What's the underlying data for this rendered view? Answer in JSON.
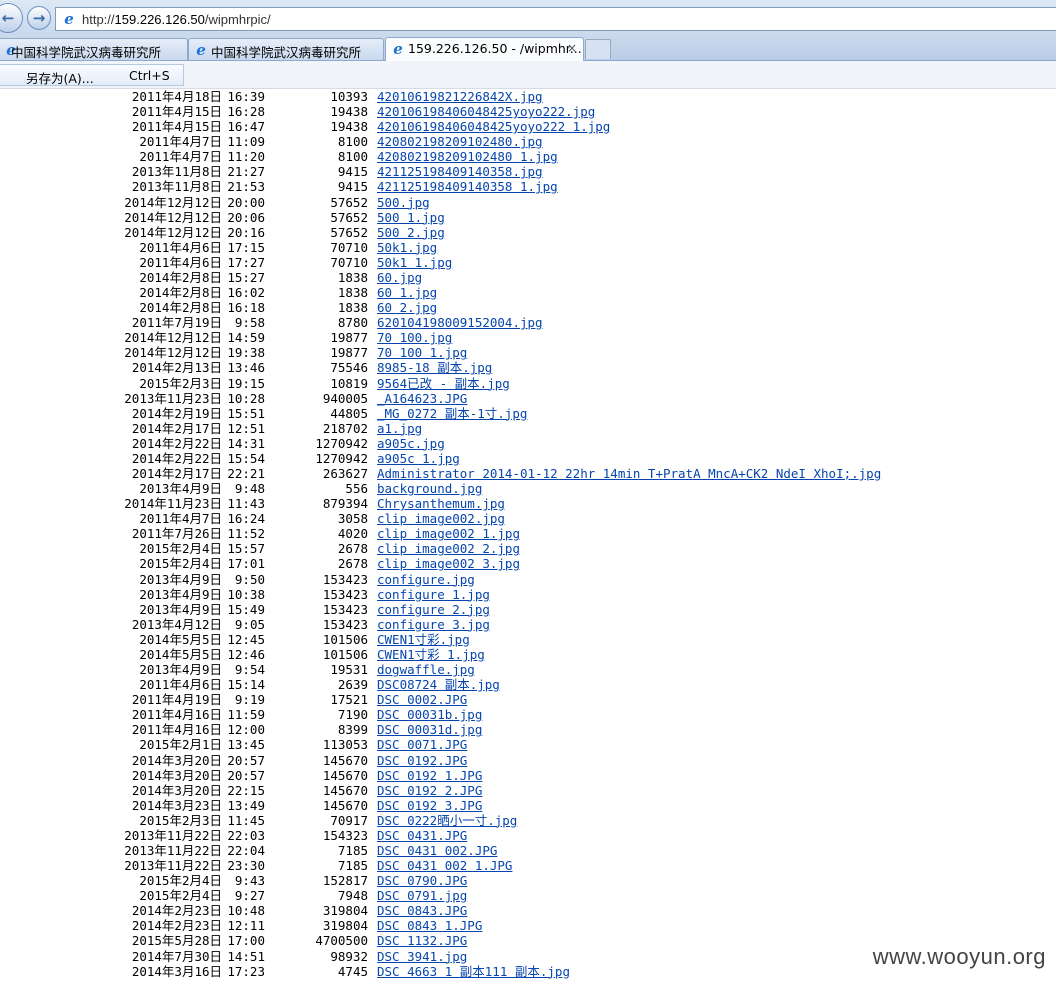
{
  "browser": {
    "url_prefix": "http://",
    "url_host": "159.226.126.50",
    "url_path": "/wipmhrpic/",
    "tabs": [
      {
        "label": "中国科学院武汉病毒研究所",
        "active": false
      },
      {
        "label": "中国科学院武汉病毒研究所",
        "active": false
      },
      {
        "label": "159.226.126.50 - /wipmhr...",
        "active": true,
        "close": "×"
      }
    ],
    "context_menu": {
      "label": "另存为(A)...",
      "shortcut": "Ctrl+S"
    },
    "icons": [
      "back-arrow-icon",
      "forward-arrow-icon",
      "ie-page-icon",
      "close-icon"
    ]
  },
  "colors": {
    "link": "#0645ad",
    "chrome": "#c9d9ec"
  },
  "files": [
    {
      "date": "2011年4月18日",
      "time": "16:39",
      "size": "10393",
      "name": "42010619821226842X.jpg"
    },
    {
      "date": "2011年4月15日",
      "time": "16:28",
      "size": "19438",
      "name": "420106198406048425yoyo222.jpg"
    },
    {
      "date": "2011年4月15日",
      "time": "16:47",
      "size": "19438",
      "name": "420106198406048425yoyo222 1.jpg"
    },
    {
      "date": "2011年4月7日",
      "time": "11:09",
      "size": "8100",
      "name": "420802198209102480.jpg"
    },
    {
      "date": "2011年4月7日",
      "time": "11:20",
      "size": "8100",
      "name": "420802198209102480 1.jpg"
    },
    {
      "date": "2013年11月8日",
      "time": "21:27",
      "size": "9415",
      "name": "421125198409140358.jpg"
    },
    {
      "date": "2013年11月8日",
      "time": "21:53",
      "size": "9415",
      "name": "421125198409140358 1.jpg"
    },
    {
      "date": "2014年12月12日",
      "time": "20:00",
      "size": "57652",
      "name": "500.jpg"
    },
    {
      "date": "2014年12月12日",
      "time": "20:06",
      "size": "57652",
      "name": "500 1.jpg"
    },
    {
      "date": "2014年12月12日",
      "time": "20:16",
      "size": "57652",
      "name": "500 2.jpg"
    },
    {
      "date": "2011年4月6日",
      "time": "17:15",
      "size": "70710",
      "name": "50k1.jpg"
    },
    {
      "date": "2011年4月6日",
      "time": "17:27",
      "size": "70710",
      "name": "50k1 1.jpg"
    },
    {
      "date": "2014年2月8日",
      "time": "15:27",
      "size": "1838",
      "name": "60.jpg"
    },
    {
      "date": "2014年2月8日",
      "time": "16:02",
      "size": "1838",
      "name": "60 1.jpg"
    },
    {
      "date": "2014年2月8日",
      "time": "16:18",
      "size": "1838",
      "name": "60 2.jpg"
    },
    {
      "date": "2011年7月19日",
      "time": "9:58",
      "size": "8780",
      "name": "620104198009152004.jpg"
    },
    {
      "date": "2014年12月12日",
      "time": "14:59",
      "size": "19877",
      "name": "70 100.jpg"
    },
    {
      "date": "2014年12月12日",
      "time": "19:38",
      "size": "19877",
      "name": "70 100 1.jpg"
    },
    {
      "date": "2014年2月13日",
      "time": "13:46",
      "size": "75546",
      "name": "8985-18 副本.jpg"
    },
    {
      "date": "2015年2月3日",
      "time": "19:15",
      "size": "10819",
      "name": "9564已改 - 副本.jpg"
    },
    {
      "date": "2013年11月23日",
      "time": "10:28",
      "size": "940005",
      "name": "_A164623.JPG"
    },
    {
      "date": "2014年2月19日",
      "time": "15:51",
      "size": "44805",
      "name": "_MG_0272 副本-1寸.jpg"
    },
    {
      "date": "2014年2月17日",
      "time": "12:51",
      "size": "218702",
      "name": "a1.jpg"
    },
    {
      "date": "2014年2月22日",
      "time": "14:31",
      "size": "1270942",
      "name": "a905c.jpg"
    },
    {
      "date": "2014年2月22日",
      "time": "15:54",
      "size": "1270942",
      "name": "a905c 1.jpg"
    },
    {
      "date": "2014年2月17日",
      "time": "22:21",
      "size": "263627",
      "name": "Administrator 2014-01-12 22hr 14min T+PratA MncA+CK2 NdeI XhoI;.jpg"
    },
    {
      "date": "2013年4月9日",
      "time": "9:48",
      "size": "556",
      "name": "background.jpg"
    },
    {
      "date": "2014年11月23日",
      "time": "11:43",
      "size": "879394",
      "name": "Chrysanthemum.jpg"
    },
    {
      "date": "2011年4月7日",
      "time": "16:24",
      "size": "3058",
      "name": "clip image002.jpg"
    },
    {
      "date": "2011年7月26日",
      "time": "11:52",
      "size": "4020",
      "name": "clip image002 1.jpg"
    },
    {
      "date": "2015年2月4日",
      "time": "15:57",
      "size": "2678",
      "name": "clip image002 2.jpg"
    },
    {
      "date": "2015年2月4日",
      "time": "17:01",
      "size": "2678",
      "name": "clip image002 3.jpg"
    },
    {
      "date": "2013年4月9日",
      "time": "9:50",
      "size": "153423",
      "name": "configure.jpg"
    },
    {
      "date": "2013年4月9日",
      "time": "10:38",
      "size": "153423",
      "name": "configure 1.jpg"
    },
    {
      "date": "2013年4月9日",
      "time": "15:49",
      "size": "153423",
      "name": "configure 2.jpg"
    },
    {
      "date": "2013年4月12日",
      "time": "9:05",
      "size": "153423",
      "name": "configure 3.jpg"
    },
    {
      "date": "2014年5月5日",
      "time": "12:45",
      "size": "101506",
      "name": "CWEN1寸彩.jpg"
    },
    {
      "date": "2014年5月5日",
      "time": "12:46",
      "size": "101506",
      "name": "CWEN1寸彩 1.jpg"
    },
    {
      "date": "2013年4月9日",
      "time": "9:54",
      "size": "19531",
      "name": "dogwaffle.jpg"
    },
    {
      "date": "2011年4月6日",
      "time": "15:14",
      "size": "2639",
      "name": "DSC08724 副本.jpg"
    },
    {
      "date": "2011年4月19日",
      "time": "9:19",
      "size": "17521",
      "name": "DSC 0002.JPG"
    },
    {
      "date": "2011年4月16日",
      "time": "11:59",
      "size": "7190",
      "name": "DSC 00031b.jpg"
    },
    {
      "date": "2011年4月16日",
      "time": "12:00",
      "size": "8399",
      "name": "DSC 00031d.jpg"
    },
    {
      "date": "2015年2月1日",
      "time": "13:45",
      "size": "113053",
      "name": "DSC 0071.JPG"
    },
    {
      "date": "2014年3月20日",
      "time": "20:57",
      "size": "145670",
      "name": "DSC 0192.JPG"
    },
    {
      "date": "2014年3月20日",
      "time": "20:57",
      "size": "145670",
      "name": "DSC 0192 1.JPG"
    },
    {
      "date": "2014年3月20日",
      "time": "22:15",
      "size": "145670",
      "name": "DSC 0192 2.JPG"
    },
    {
      "date": "2014年3月23日",
      "time": "13:49",
      "size": "145670",
      "name": "DSC 0192 3.JPG"
    },
    {
      "date": "2015年2月3日",
      "time": "11:45",
      "size": "70917",
      "name": "DSC 0222晒小一寸.jpg"
    },
    {
      "date": "2013年11月22日",
      "time": "22:03",
      "size": "154323",
      "name": "DSC 0431.JPG"
    },
    {
      "date": "2013年11月22日",
      "time": "22:04",
      "size": "7185",
      "name": "DSC 0431 002.JPG"
    },
    {
      "date": "2013年11月22日",
      "time": "23:30",
      "size": "7185",
      "name": "DSC 0431 002 1.JPG"
    },
    {
      "date": "2015年2月4日",
      "time": "9:43",
      "size": "152817",
      "name": "DSC 0790.JPG"
    },
    {
      "date": "2015年2月4日",
      "time": "9:27",
      "size": "7948",
      "name": "DSC 0791.jpg"
    },
    {
      "date": "2014年2月23日",
      "time": "10:48",
      "size": "319804",
      "name": "DSC 0843.JPG"
    },
    {
      "date": "2014年2月23日",
      "time": "12:11",
      "size": "319804",
      "name": "DSC 0843 1.JPG"
    },
    {
      "date": "2015年5月28日",
      "time": "17:00",
      "size": "4700500",
      "name": "DSC 1132.JPG"
    },
    {
      "date": "2014年7月30日",
      "time": "14:51",
      "size": "98932",
      "name": "DSC 3941.jpg"
    },
    {
      "date": "2014年3月16日",
      "time": "17:23",
      "size": "4745",
      "name": "DSC 4663 1 副本111 副本.jpg"
    }
  ],
  "watermark": "www.wooyun.org"
}
